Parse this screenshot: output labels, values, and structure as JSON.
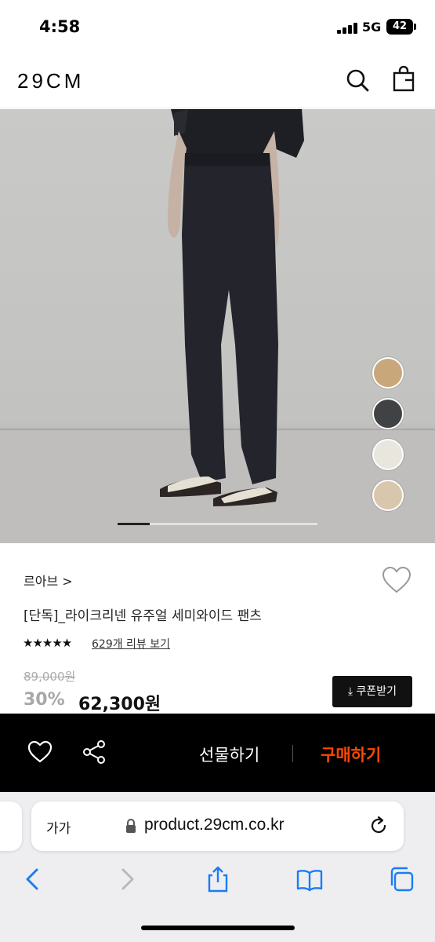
{
  "status_bar": {
    "time": "4:58",
    "network": "5G",
    "battery": "42"
  },
  "header": {
    "logo": "29CM",
    "search_icon": "search-icon",
    "bag_icon": "shopping-bag-icon"
  },
  "gallery": {
    "swatches": [
      "#c8a77b",
      "#414244",
      "#e9e6de",
      "#d9c7ad"
    ],
    "progress_fraction": 0.16
  },
  "product": {
    "brand": "르아브 >",
    "name": "[단독]_라이크리넨 유주얼 세미와이드 팬츠",
    "rating_stars": "★★★★★",
    "review_link": "629개 리뷰 보기",
    "original_price": "89,000원",
    "discount": "30%",
    "price": "62,300원",
    "coupon_button": "⤓ 쿠폰받기"
  },
  "action_bar": {
    "gift_button": "선물하기",
    "buy_button": "구매하기",
    "buy_color": "#ff4800"
  },
  "browser": {
    "text_size_button": "가가",
    "url": "product.29cm.co.kr"
  }
}
